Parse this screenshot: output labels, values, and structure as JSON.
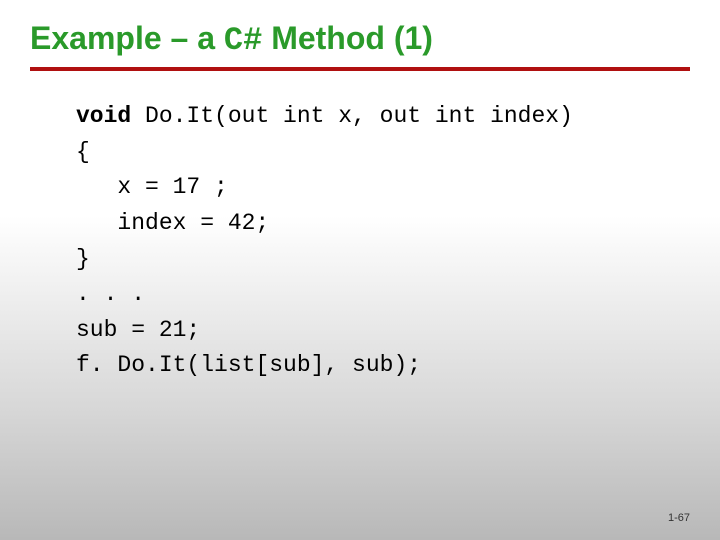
{
  "title": {
    "prefix": "Example – a ",
    "mono": "C#",
    "suffix": " Method (1)"
  },
  "code": {
    "l1_kw": "void",
    "l1_rest": " Do.It(out int x, out int index)",
    "l2": "{",
    "l3": "   x = 17 ;",
    "l4": "   index = 42;",
    "l5": "}",
    "l6": ". . .",
    "l7": "sub = 21;",
    "l8": "f. Do.It(list[sub], sub);"
  },
  "page_number": "1-67"
}
